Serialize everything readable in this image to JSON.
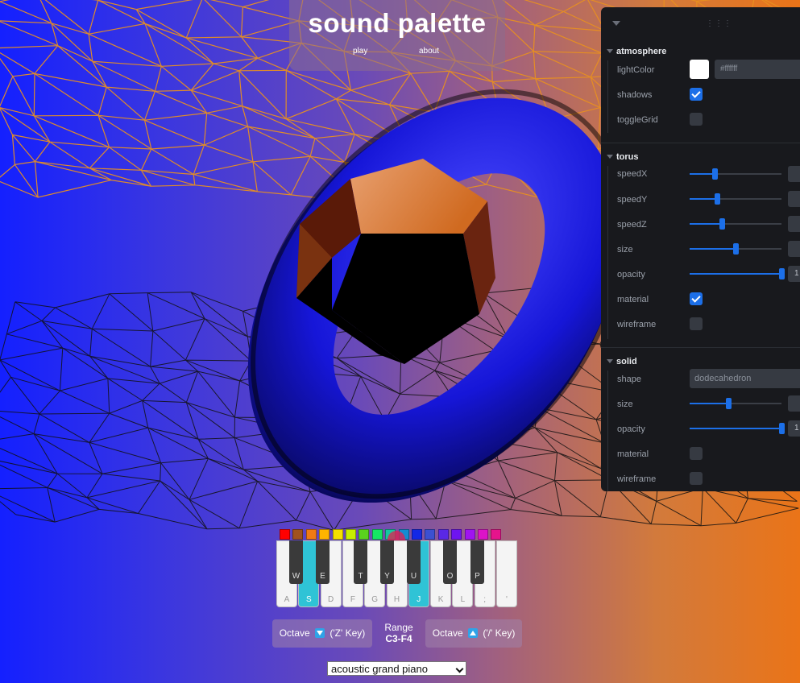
{
  "app": {
    "title": "sound palette",
    "nav": [
      {
        "label": "play"
      },
      {
        "label": "about"
      }
    ]
  },
  "panel": {
    "folders": [
      {
        "title": "atmosphere",
        "controls": [
          {
            "label": "lightColor",
            "type": "color",
            "value": "#ffffff"
          },
          {
            "label": "shadows",
            "type": "checkbox",
            "checked": true
          },
          {
            "label": "toggleGrid",
            "type": "checkbox",
            "checked": false
          }
        ]
      },
      {
        "title": "torus",
        "controls": [
          {
            "label": "speedX",
            "type": "slider",
            "fraction": 0.27
          },
          {
            "label": "speedY",
            "type": "slider",
            "fraction": 0.3
          },
          {
            "label": "speedZ",
            "type": "slider",
            "fraction": 0.35
          },
          {
            "label": "size",
            "type": "slider",
            "fraction": 0.5
          },
          {
            "label": "opacity",
            "type": "slider",
            "fraction": 1.0,
            "number_text": "1"
          },
          {
            "label": "material",
            "type": "checkbox",
            "checked": true
          },
          {
            "label": "wireframe",
            "type": "checkbox",
            "checked": false
          }
        ]
      },
      {
        "title": "solid",
        "controls": [
          {
            "label": "shape",
            "type": "select",
            "value": "dodecahedron"
          },
          {
            "label": "size",
            "type": "slider",
            "fraction": 0.42
          },
          {
            "label": "opacity",
            "type": "slider",
            "fraction": 1.0,
            "number_text": "1"
          },
          {
            "label": "material",
            "type": "checkbox",
            "checked": false
          },
          {
            "label": "wireframe",
            "type": "checkbox",
            "checked": false
          }
        ]
      }
    ]
  },
  "palette": {
    "colors": [
      "#ff0000",
      "#a0521e",
      "#f07a14",
      "#ffb400",
      "#f5e000",
      "#c8f000",
      "#5ad21e",
      "#14e664",
      "#14c8a0",
      "#148cd2",
      "#1428e6",
      "#3c50d2",
      "#5a28e6",
      "#6e14f0",
      "#a014f0",
      "#dc14c8",
      "#e6148c"
    ]
  },
  "keyboard": {
    "white_keys": [
      {
        "label": "A",
        "active": false
      },
      {
        "label": "S",
        "active": true
      },
      {
        "label": "D",
        "active": false
      },
      {
        "label": "F",
        "active": false
      },
      {
        "label": "G",
        "active": false
      },
      {
        "label": "H",
        "active": false
      },
      {
        "label": "J",
        "active": true
      },
      {
        "label": "K",
        "active": false
      },
      {
        "label": "L",
        "active": false
      },
      {
        "label": ";",
        "active": false
      },
      {
        "label": "'",
        "active": false
      }
    ],
    "black_keys": [
      {
        "label": "W",
        "active": false
      },
      {
        "label": "E",
        "active": false
      },
      {
        "label": "T",
        "active": false
      },
      {
        "label": "Y",
        "active": false
      },
      {
        "label": "U",
        "active": false
      },
      {
        "label": "O",
        "active": false
      },
      {
        "label": "P",
        "active": false
      }
    ],
    "octave_down_label": "Octave",
    "octave_down_hint": "('Z' Key)",
    "octave_up_label": "Octave",
    "octave_up_hint": "('/' Key)",
    "range_label": "Range",
    "range_value": "C3-F4",
    "instrument": "acoustic grand piano"
  },
  "colors": {
    "accent": "#1c6fe8",
    "key_active": "#2fc3d6",
    "torus": "#1a1ae8",
    "solid": "#c86a2a",
    "grid_orange": "#e89020"
  }
}
